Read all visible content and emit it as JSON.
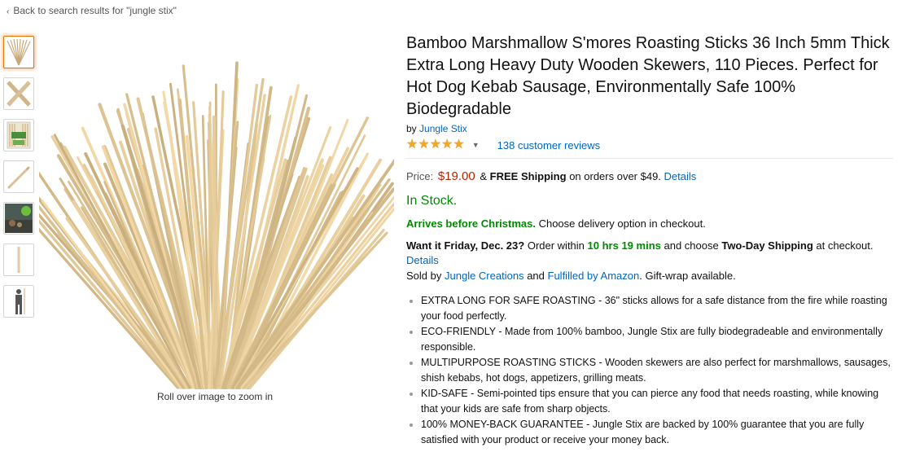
{
  "breadcrumb": {
    "label": "Back to search results for \"jungle stix\""
  },
  "gallery": {
    "thumbnails": [
      "sticks-bundle",
      "crossed-sticks",
      "package",
      "single-stick",
      "campfire-scene",
      "stick-vertical",
      "person-silhouette"
    ],
    "zoom_hint": "Roll over image to zoom in"
  },
  "product": {
    "title": "Bamboo Marshmallow S'mores Roasting Sticks 36 Inch 5mm Thick Extra Long Heavy Duty Wooden Skewers, 110 Pieces. Perfect for Hot Dog Kebab Sausage, Environmentally Safe 100% Biodegradable",
    "by_prefix": "by",
    "brand": "Jungle Stix",
    "rating_stars": 5,
    "reviews": "138 customer reviews",
    "price_label": "Price:",
    "price": "$19.00",
    "shipping_amp": "&",
    "free_shipping": "FREE Shipping",
    "shipping_suffix": "on orders over $49.",
    "details_link": "Details",
    "stock": "In Stock.",
    "arrives_bold": "Arrives before Christmas.",
    "arrives_rest": "Choose delivery option in checkout.",
    "want_bold": "Want it Friday, Dec. 23?",
    "want_mid": "Order within",
    "want_time": "10 hrs 19 mins",
    "want_and": "and choose",
    "want_shipping": "Two-Day Shipping",
    "want_end": "at checkout.",
    "want_details": "Details",
    "sold_by_prefix": "Sold by",
    "seller": "Jungle Creations",
    "sold_and": "and",
    "fulfilled": "Fulfilled by Amazon",
    "gift": ". Gift-wrap available.",
    "bullets": [
      "EXTRA LONG FOR SAFE ROASTING - 36\" sticks allows for a safe distance from the fire while roasting your food perfectly.",
      "ECO-FRIENDLY - Made from 100% bamboo, Jungle Stix are fully biodegradeable and environmentally responsible.",
      "MULTIPURPOSE ROASTING STICKS - Wooden skewers are also perfect for marshmallows, sausages, shish kebabs, hot dogs, appetizers, grilling meats.",
      "KID-SAFE - Semi-pointed tips ensure that you can pierce any food that needs roasting, while knowing that your kids are safe from sharp objects.",
      "100% MONEY-BACK GUARANTEE - Jungle Stix are backed by 100% guarantee that you are fully satisfied with your product or receive your money back."
    ]
  },
  "colors": {
    "price": "#b12704",
    "stock": "#008a00",
    "link": "#0066c0",
    "star": "#f6a623"
  }
}
